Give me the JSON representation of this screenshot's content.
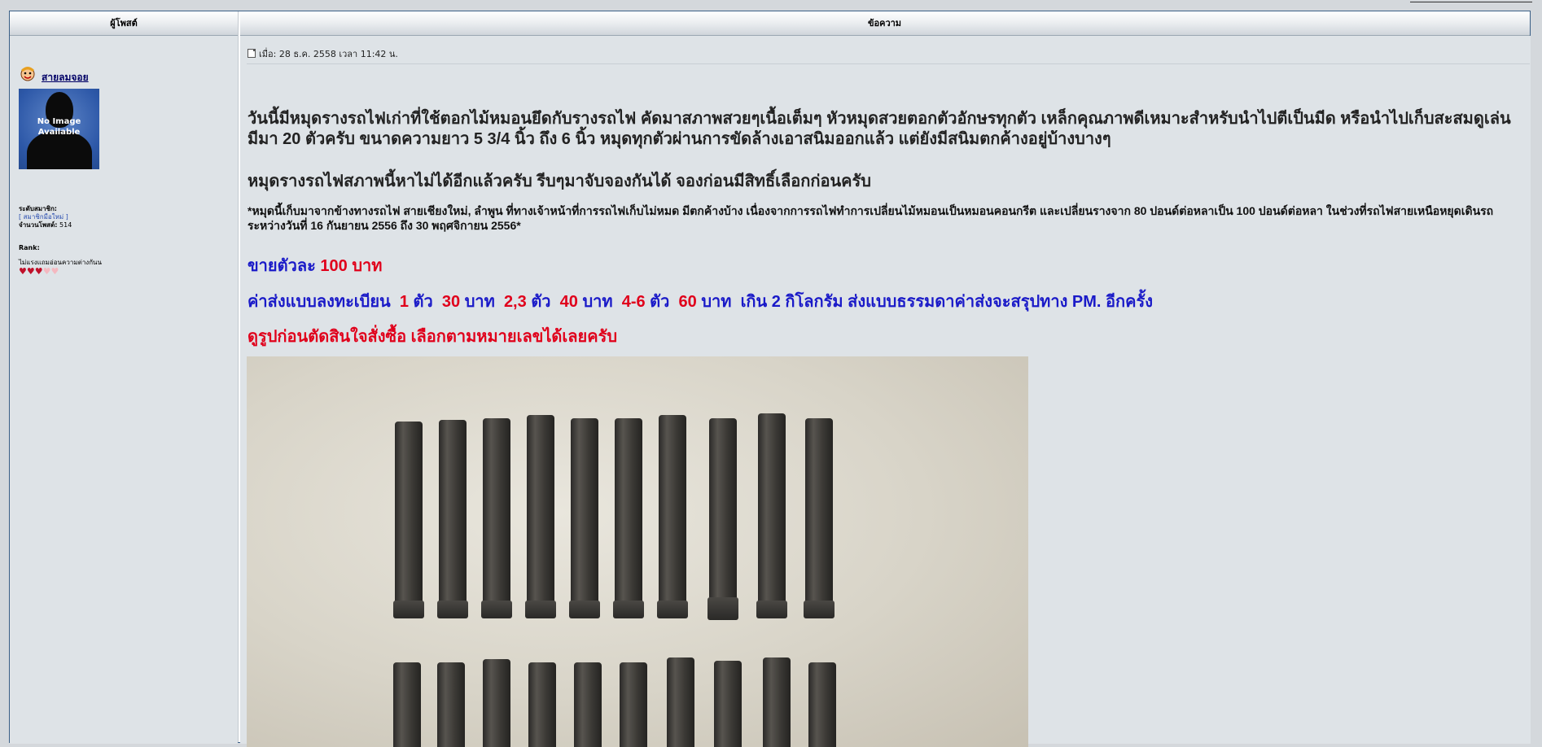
{
  "table": {
    "author_header": "ผู้โพสต์",
    "message_header": "ข้อความ"
  },
  "author": {
    "name": "สายลมจอย",
    "avatar_text_line1": "No Image",
    "avatar_text_line2": "Available",
    "level_label": "ระดับสมาชิก",
    "level_value": "[ สมาชิกมือใหม่ ]",
    "posts_label": "จำนวนโพสต์",
    "posts_value": "514",
    "rank_label": "Rank:",
    "rank_text": "ไม่แรงแถมอ่อนความต่างกันน",
    "hearts_filled": 3,
    "hearts_total": 5,
    "icons": {
      "avatar": "cartoon-face-icon"
    }
  },
  "post": {
    "date_label": "เมื่อ: 28 ธ.ค. 2558 เวลา 11:42 น.",
    "p1": "วันนี้มีหมุดรางรถไฟเก่าที่ใช้ตอกไม้หมอนยึดกับรางรถไฟ คัดมาสภาพสวยๆเนื้อเต็มๆ หัวหมุดสวยตอกตัวอักษรทุกตัว เหล็กคุณภาพดีเหมาะสำหรับนำไปตีเป็นมีด หรือนำไปเก็บสะสมดูเล่น  มีมา 20 ตัวครับ  ขนาดความยาว 5 3/4 นิ้ว ถึง 6 นิ้ว  หมุดทุกตัวผ่านการขัดล้างเอาสนิมออกแล้ว แต่ยังมีสนิมตกค้างอยู่บ้างบางๆ",
    "p2": "หมุดรางรถไฟสภาพนี้หาไม่ได้อีกแล้วครับ รีบๆมาจับจองกันได้ จองก่อนมีสิทธิ์เลือกก่อนครับ",
    "p3": "*หมุดนี้เก็บมาจากข้างทางรถไฟ สายเชียงใหม่, ลำพูน ที่ทางเจ้าหน้าที่การรถไฟเก็บไม่หมด มีตกค้างบ้าง  เนื่องจากการรถไฟทำการเปลี่ยนไม้หมอนเป็นหมอนคอนกรีต  และเปลี่ยนรางจาก 80 ปอนด์ต่อหลาเป็น 100 ปอนด์ต่อหลา ในช่วงที่รถไฟสายเหนือหยุดเดินรถระหว่างวันที่ 16 กันยายน 2556 ถึง 30 พฤศจิกายน 2556*",
    "price": {
      "label": "ขายตัวละ",
      "amount": "100 บาท"
    },
    "shipping": {
      "label": "ค่าส่งแบบลงทะเบียน",
      "q1": "1",
      "unit": "ตัว",
      "p1": "30",
      "baht": "บาท",
      "q2": "2,3",
      "p2": "40",
      "q3": "4-6",
      "p3": "60",
      "rest": "เกิน 2 กิโลกรัม ส่งแบบธรรมดาค่าส่งจะสรุปทาง PM. อีกครั้ง"
    },
    "p6": "ดูรูปก่อนตัดสินใจสั่งซื้อ เลือกตามหมายเลขได้เลยครับ",
    "photo_alt": "railroad-spikes-photo"
  }
}
